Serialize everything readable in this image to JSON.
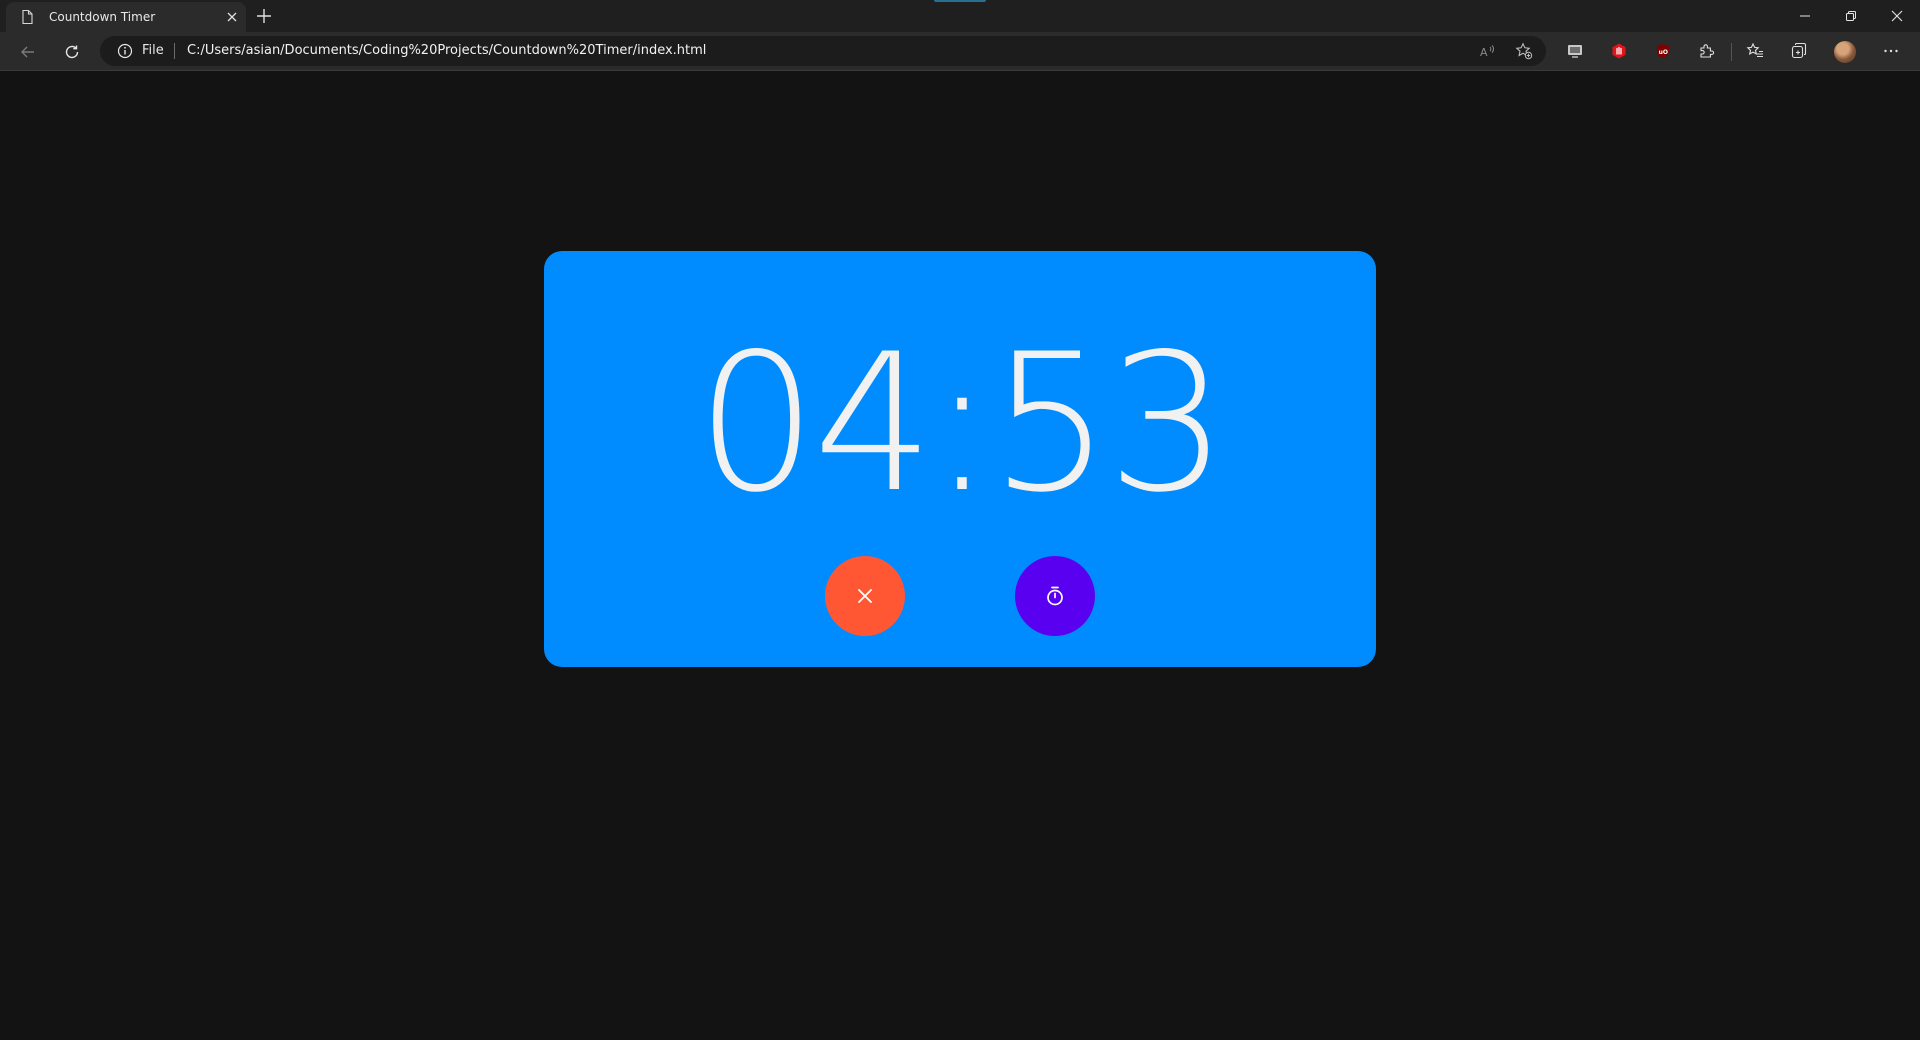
{
  "browser": {
    "tab": {
      "title": "Countdown Timer",
      "favicon": "page-icon",
      "close_icon": "close-icon"
    },
    "new_tab_icon": "plus-icon",
    "window_controls": [
      "minimize-icon",
      "restore-icon",
      "close-icon"
    ],
    "address_bar": {
      "security_icon": "info-icon",
      "scheme_label": "File",
      "url": "C:/Users/asian/Documents/Coding%20Projects/Countdown%20Timer/index.html",
      "actions": [
        "read-aloud-icon",
        "add-favorite-icon"
      ]
    },
    "toolbar_icons": [
      "back-arrow-icon",
      "refresh-icon",
      "extension-screen-icon",
      "extension-red-hand-icon",
      "ublock-icon",
      "extensions-puzzle-icon",
      "favorites-icon",
      "collections-icon",
      "profile-avatar",
      "more-menu-icon"
    ]
  },
  "app": {
    "timer": "04:53",
    "buttons": {
      "reset": {
        "icon": "close-icon",
        "color": "#ff5733"
      },
      "start": {
        "icon": "stopwatch-icon",
        "color": "#5a00f0"
      }
    },
    "card_color": "#008cff",
    "background_color": "#131313"
  }
}
